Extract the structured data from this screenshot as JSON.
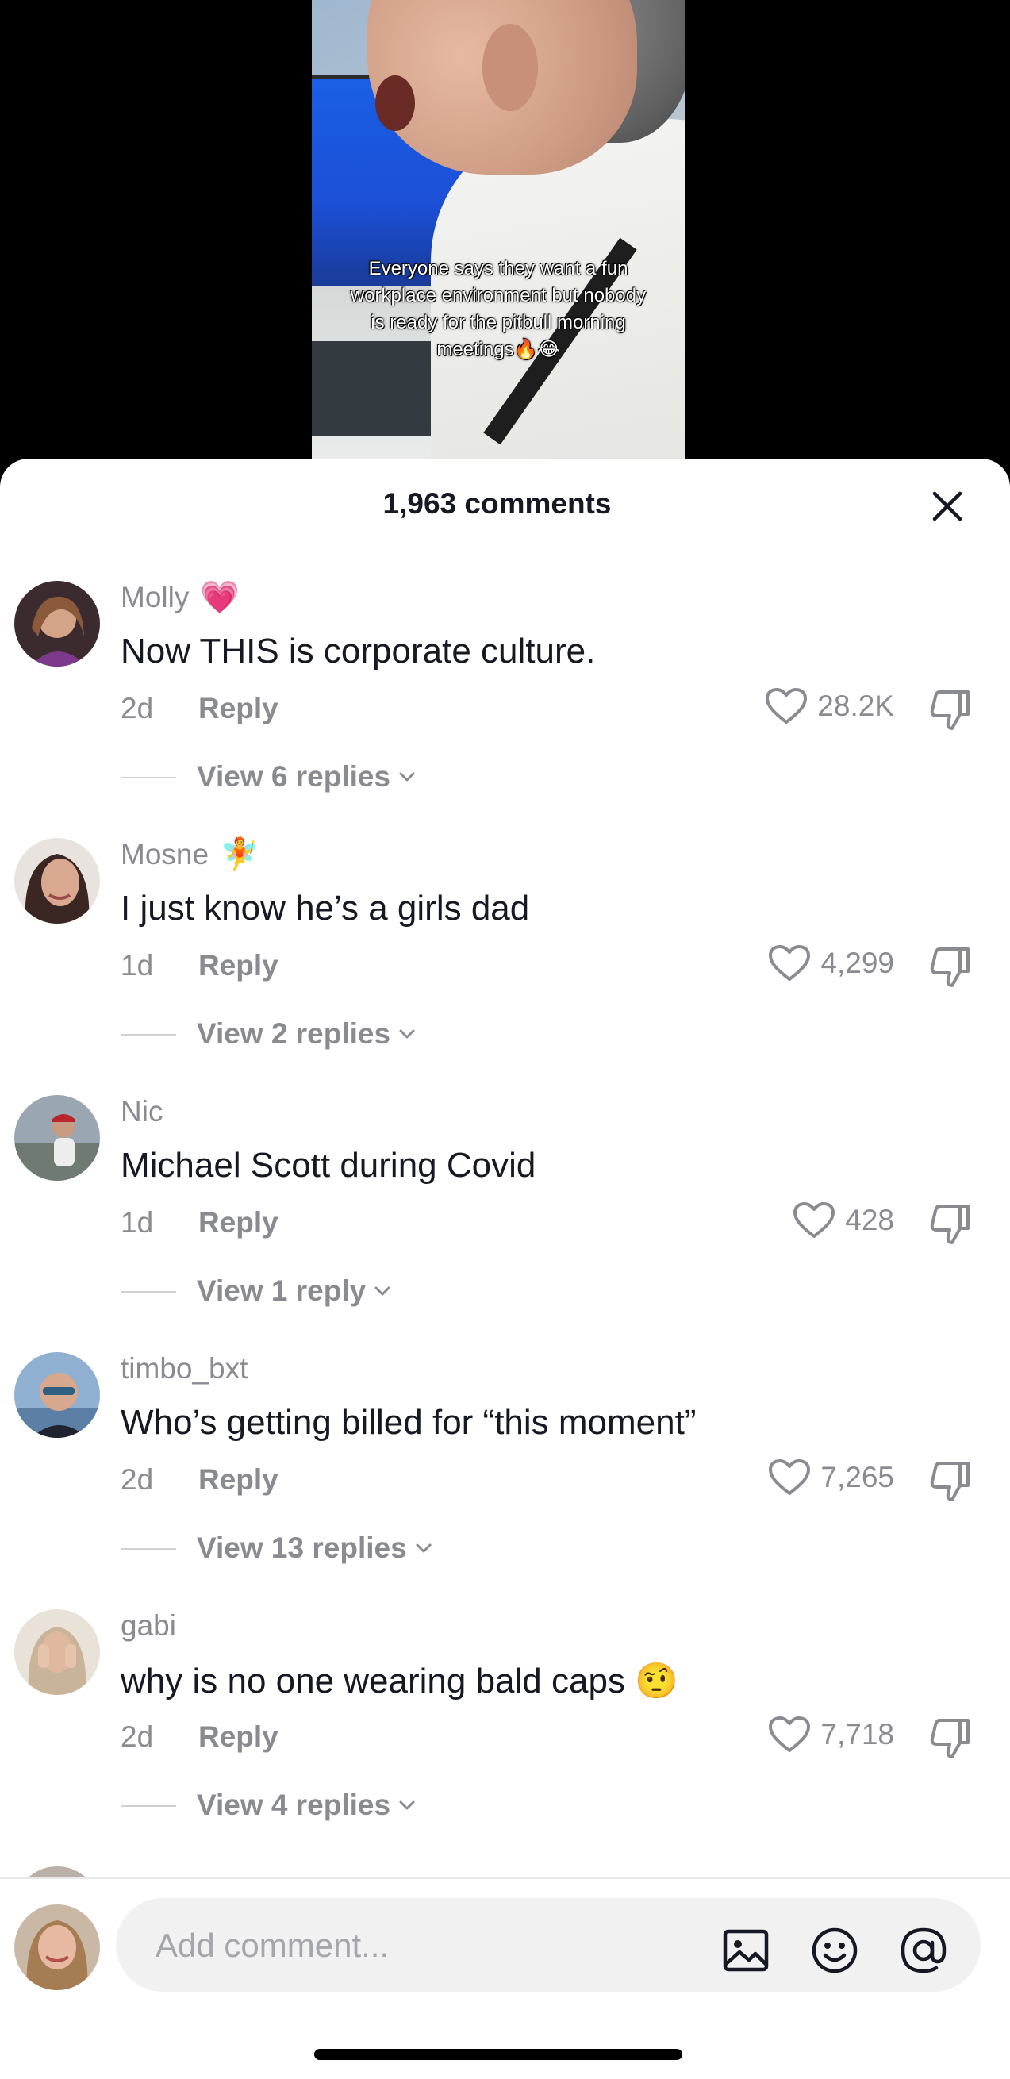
{
  "video": {
    "caption": "Everyone says they want a fun workplace environment but nobody is ready for the pitbull morning meetings🔥😂"
  },
  "header": {
    "comments_count": "1,963 comments",
    "close_icon": "close-icon"
  },
  "comments": [
    {
      "username": "Molly",
      "badge": "💗",
      "text": "Now THIS is corporate culture.",
      "age": "2d",
      "reply": "Reply",
      "likes": "28.2K",
      "view_replies": "View 6 replies",
      "avatar_color": "#8a5a4a"
    },
    {
      "username": "Mosne",
      "badge": "🧚",
      "text": "I just know he’s a girls dad",
      "age": "1d",
      "reply": "Reply",
      "likes": "4,299",
      "view_replies": "View 2 replies",
      "avatar_color": "#5e4338"
    },
    {
      "username": "Nic",
      "badge": "",
      "text": "Michael Scott during Covid",
      "age": "1d",
      "reply": "Reply",
      "likes": "428",
      "view_replies": "View 1 reply",
      "avatar_color": "#7c8a94"
    },
    {
      "username": "timbo_bxt",
      "badge": "",
      "text": "Who’s getting billed for “this moment”",
      "age": "2d",
      "reply": "Reply",
      "likes": "7,265",
      "view_replies": "View 13 replies",
      "avatar_color": "#6b8bb0"
    },
    {
      "username": "gabi",
      "badge": "",
      "text": "why is no one wearing bald caps 🤨",
      "age": "2d",
      "reply": "Reply",
      "likes": "7,718",
      "view_replies": "View 4 replies",
      "avatar_color": "#d8c9b8"
    }
  ],
  "input": {
    "placeholder": "Add comment...",
    "icons": [
      "image-icon",
      "emoji-icon",
      "mention-icon"
    ]
  },
  "colors": {
    "text_primary": "#161823",
    "text_secondary": "#8a8b91",
    "input_bg": "#f1f1f2"
  }
}
